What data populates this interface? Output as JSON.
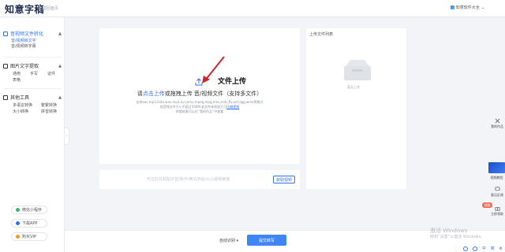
{
  "header": {
    "logo": "知意字稿",
    "logo_sub": "返回首页",
    "brand_menu": "知意软件大全"
  },
  "sidebar": {
    "groups": [
      {
        "title": "音视频文件转化",
        "items": [
          "音/视频转文字",
          "音/视频转字幕"
        ]
      },
      {
        "title": "图片文字提取",
        "items": [
          "通用",
          "手写",
          "证件",
          "表格"
        ]
      },
      {
        "title": "其他工具",
        "items": [
          "多语言转换",
          "繁繁转换",
          "大小转换",
          "拼音转换"
        ]
      }
    ],
    "buttons": [
      "微信小程序",
      "下载APP",
      "购买VIP"
    ]
  },
  "upload": {
    "main_pre": "请",
    "main_link": "点击上传",
    "main_post": "或拖拽上传 音/视频文件（支持多文件）",
    "help1": "支持aac,mp3,m4a,wav,mp4,avi,wmv,mpeg,mpg,mov,m4v,flv,asf,ogg,wma等格式",
    "help2_pre": "低音频文件大小不超过500M,若文件体积较大可",
    "help2_link": "压缩视频",
    "help3": "转换结果可以在“我的作品”中查看",
    "annotation": "文件上传"
  },
  "link_bar": {
    "placeholder": "可在此处粘贴抖音/快手/西瓜/B站/火山视频链接",
    "parse_button": "获取视频"
  },
  "file_list": {
    "title": "上传文件列表",
    "empty": "暂无上传"
  },
  "bottom": {
    "mode": "自动识别",
    "submit": "提交转写"
  },
  "right_tools": {
    "items": [
      "我的作品",
      "视频教程",
      "意见反馈",
      "立即领取"
    ],
    "badge": "领取"
  },
  "watermark": {
    "line1": "激活 Windows",
    "line2": "转到“设置”以激活 Windows。"
  },
  "tray": [
    "中",
    "简"
  ],
  "colors": {
    "accent": "#3273f6",
    "submit": "#3e86f8",
    "annotation_arrow": "#d0242b"
  }
}
